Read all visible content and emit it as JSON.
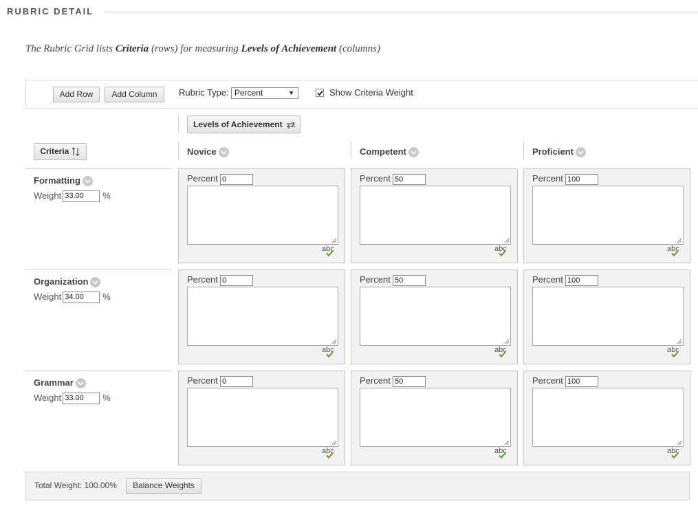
{
  "section": {
    "title": "RUBRIC DETAIL"
  },
  "intro": {
    "part1": "The Rubric Grid lists ",
    "criteria_word": "Criteria",
    "part2": " (rows) for measuring ",
    "levels_word": "Levels of Achievement",
    "part3": " (columns)"
  },
  "toolbar": {
    "add_row": "Add Row",
    "add_column": "Add Column",
    "rubric_type_label": "Rubric Type:",
    "rubric_type_value": "Percent",
    "show_weight_label": "Show Criteria Weight",
    "show_weight_checked": true
  },
  "grid": {
    "levels_button": "Levels of Achievement",
    "criteria_button": "Criteria",
    "levels": [
      "Novice",
      "Competent",
      "Proficient"
    ],
    "percent_label": "Percent",
    "spell_label": "abc",
    "weight_label": "Weight",
    "percent_sign": "%",
    "criteria": [
      {
        "name": "Formatting",
        "weight": "33.00",
        "percents": [
          "0",
          "50",
          "100"
        ]
      },
      {
        "name": "Organization",
        "weight": "34.00",
        "percents": [
          "0",
          "50",
          "100"
        ]
      },
      {
        "name": "Grammar",
        "weight": "33.00",
        "percents": [
          "0",
          "50",
          "100"
        ]
      }
    ]
  },
  "footer": {
    "total_weight_label": "Total Weight:",
    "total_weight_value": "100.00%",
    "balance_button": "Balance Weights"
  },
  "colors": {
    "check_green": "#5a9e1c",
    "chevron_gray": "#c9c9c9"
  }
}
